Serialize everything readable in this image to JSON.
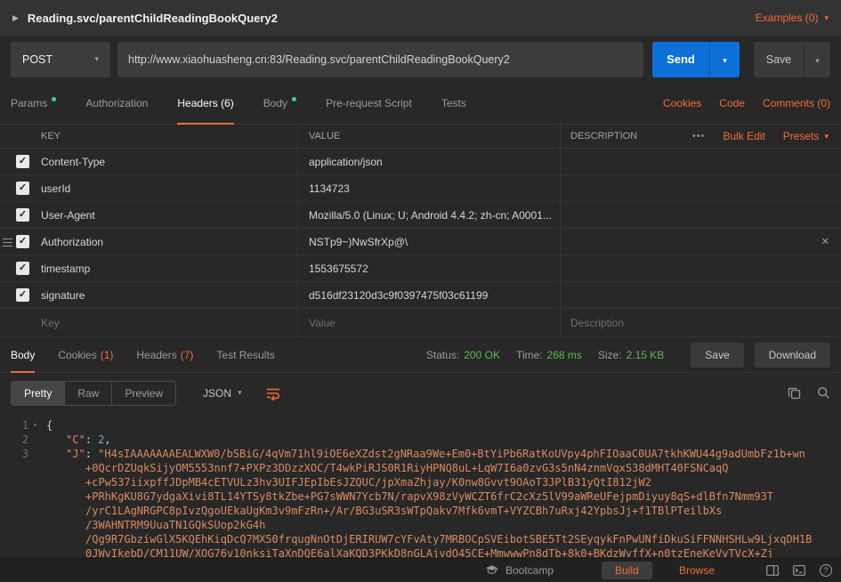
{
  "colors": {
    "accent_orange": "#f26b3a",
    "send_blue": "#0d6fd8",
    "success_green": "#5fb454",
    "tab_dot_green": "#49cc90"
  },
  "icons": {
    "collapse_arrow": "▶",
    "caret_down": "▾",
    "more_dots": "•••",
    "close": "✕",
    "check": "✓",
    "fold_caret": "▾",
    "help": "?"
  },
  "topbar": {
    "title": "Reading.svc/parentChildReadingBookQuery2",
    "examples_label": "Examples (0)"
  },
  "request_bar": {
    "method": "POST",
    "url": "http://www.xiaohuasheng.cn:83/Reading.svc/parentChildReadingBookQuery2",
    "send_label": "Send",
    "save_label": "Save"
  },
  "request_tabs": {
    "params": "Params",
    "authorization": "Authorization",
    "headers": "Headers (6)",
    "body": "Body",
    "prerequest": "Pre-request Script",
    "tests": "Tests",
    "cookies": "Cookies",
    "code": "Code",
    "comments": "Comments (0)"
  },
  "headers_table": {
    "col_key": "KEY",
    "col_value": "VALUE",
    "col_description": "DESCRIPTION",
    "bulk_edit": "Bulk Edit",
    "presets": "Presets",
    "rows": [
      {
        "key": "Content-Type",
        "value": "application/json",
        "description": ""
      },
      {
        "key": "userId",
        "value": "1134723",
        "description": ""
      },
      {
        "key": "User-Agent",
        "value": "Mozilla/5.0 (Linux; U; Android 4.4.2; zh-cn; A0001...",
        "description": ""
      },
      {
        "key": "Authorization",
        "value": "NSTp9~)NwSfrXp@\\",
        "description": ""
      },
      {
        "key": "timestamp",
        "value": "1553675572",
        "description": ""
      },
      {
        "key": "signature",
        "value": "d516df23120d3c9f0397475f03c61199",
        "description": ""
      }
    ],
    "new_row": {
      "key_placeholder": "Key",
      "value_placeholder": "Value",
      "description_placeholder": "Description"
    }
  },
  "response": {
    "tab_body": "Body",
    "tab_cookies": "Cookies",
    "tab_cookies_count": "(1)",
    "tab_headers": "Headers",
    "tab_headers_count": "(7)",
    "tab_tests": "Test Results",
    "status_label": "Status:",
    "status_value": "200 OK",
    "time_label": "Time:",
    "time_value": "268 ms",
    "size_label": "Size:",
    "size_value": "2.15 KB",
    "save_label": "Save",
    "download_label": "Download"
  },
  "viewer": {
    "mode_pretty": "Pretty",
    "mode_raw": "Raw",
    "mode_preview": "Preview",
    "format": "JSON"
  },
  "editor": {
    "line_numbers": [
      "1",
      "2",
      "3"
    ],
    "line1": "{",
    "line2": {
      "key": "\"C\"",
      "sep": ": ",
      "value": "2",
      "comma": ","
    },
    "line3": {
      "key": "\"J\"",
      "sep": ": ",
      "parts": [
        "\"H4sIAAAAAAAEALWXW0/bSBiG/4qVm71hl9iOE6eXZdst2gNRaa9We+Em0+BtYiPb6RatKoUVpy4phFIOaaC0UA7tkhKWU44g9adUmbFz1b+wn",
        "+0QcrDZUqkSijyOM5553nnf7+PXPz3DDzzXOC/T4wkPiRJS0R1RiyHPNQ8uL+LqW7I6a0zvG3s5nN4znmVqxS38dMHT40FSNCaqQ",
        "+cPw537iixpffJDpMB4cETVULz3hv3UIFJEpIbEsJZQUC/jpXmaZhjay/K0nw8Gvvt9OAoT3JPlB31yQtI812jW2",
        "+PRhKgKU8G7ydgaXivi8TL14YTSy8tkZbe+PG7sWWN7Ycb7N/rapvX98zVyWCZT6frC2cXz5lV99aWReUFejpmDiyuy8qS+dlBfn7Nmm93T",
        "/yrC1LAgNRGPC8pIvzQgoUEkaUgKm3v9mFzRn+/Ar/BG3uSR3sWTpQakv7Mfk6vmT+VYZCBh7uRxj42YpbsJj+f1TBlPTeilbXs",
        "/3WAHNTRM9UuaTN1GQkSUop2kG4h",
        "/Qg9R7GbziwGlX5KQEhKiqDcQ7MX50frqugNnOtDjERIRUW7cYFvAty7MRBOCpSVEibotSBE5Tt2SEyqykFnPwUNfiDkuSiFFNNHSHLw9LjxqDH1B",
        "0JWvIkebD/CM11UW/XOG76v10nksiTaXnDQE6alXaKQD3PKkD8nGLAjvdO45CE+MmwwwPn8dTb+8k0+BKdzWvffX+n0tzEneKeVvTVcX+Zj"
      ]
    }
  },
  "statusbar": {
    "bootcamp": "Bootcamp",
    "build": "Build",
    "browse": "Browse"
  }
}
